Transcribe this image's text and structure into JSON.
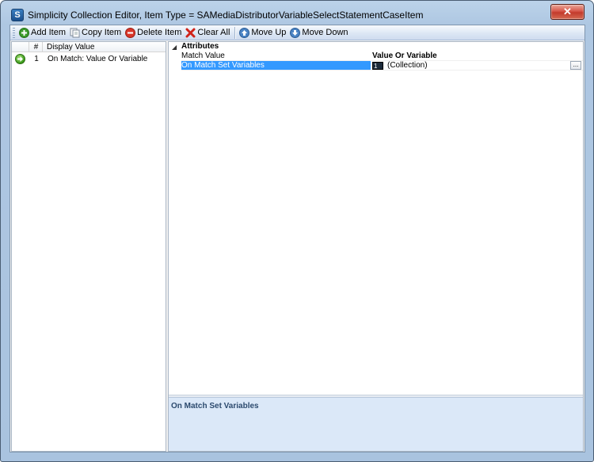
{
  "window": {
    "title": "Simplicity Collection Editor, Item Type = SAMediaDistributorVariableSelectStatementCaseItem",
    "app_icon_letter": "S",
    "close_glyph": "✕"
  },
  "toolbar": {
    "add_item": "Add Item",
    "copy_item": "Copy Item",
    "delete_item": "Delete Item",
    "clear_all": "Clear All",
    "move_up": "Move Up",
    "move_down": "Move Down"
  },
  "list": {
    "headers": {
      "number": "#",
      "display_value": "Display Value"
    },
    "rows": [
      {
        "number": "1",
        "display_value": "On Match: Value Or Variable",
        "icon": "arrow-right-green-icon"
      }
    ]
  },
  "properties": {
    "category": "Attributes",
    "collapse_glyph": "◢",
    "rows": [
      {
        "name": "Match Value",
        "value": "Value Or Variable"
      },
      {
        "name": "On Match Set Variables",
        "value_prefix": "1",
        "value": "(Collection)",
        "button": "..."
      }
    ],
    "description_title": "On Match Set Variables"
  },
  "colors": {
    "selection": "#3399ff",
    "description_bg": "#dbe8f8",
    "window_chrome": "#aec7e2"
  }
}
